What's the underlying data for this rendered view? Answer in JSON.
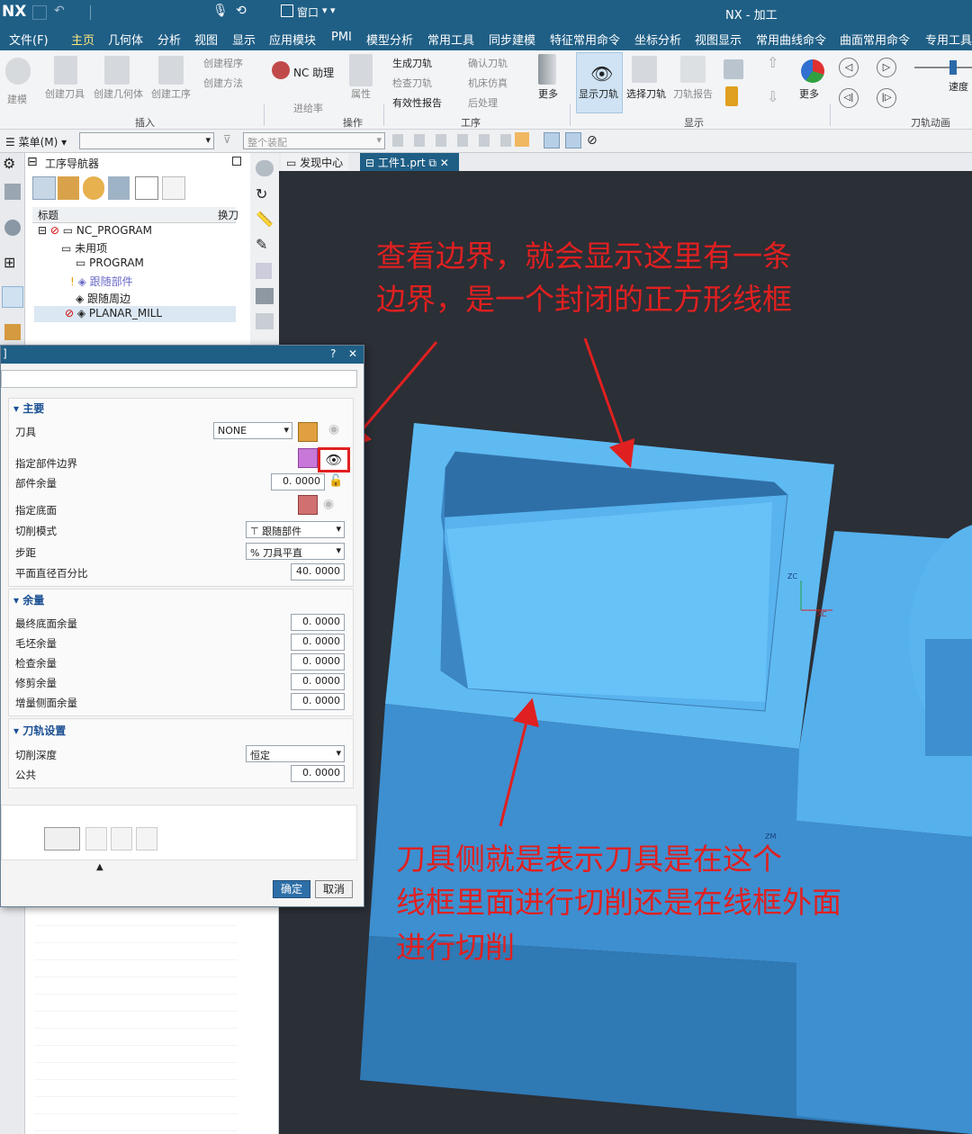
{
  "titlebar": {
    "logo": "NX",
    "window_menu": "窗口",
    "title": "NX - 加工"
  },
  "menubar": {
    "items": [
      "文件(F)",
      "主页",
      "几何体",
      "分析",
      "视图",
      "显示",
      "应用模块",
      "PMI",
      "模型分析",
      "常用工具",
      "同步建模",
      "特征常用命令",
      "坐标分析",
      "视图显示",
      "常用曲线命令",
      "曲面常用命令",
      "专用工具"
    ]
  },
  "ribbon": {
    "build": "建模",
    "create_tool": "创建刀具",
    "create_geometry": "创建几何体",
    "create_operation": "创建工序",
    "create_program": "创建程序",
    "create_method": "创建方法",
    "group_insert": "插入",
    "nc_assist": "NC 助理",
    "attributes": "属性",
    "feed_rate": "进给率",
    "group_operation": "操作",
    "generate_path": "生成刀轨",
    "verify_path": "确认刀轨",
    "check_tool": "检查刀轨",
    "machine_sim": "机床仿真",
    "validity_report": "有效性报告",
    "post_process": "后处理",
    "more1": "更多",
    "group_process": "工序",
    "show_path": "显示刀轨",
    "select_path": "选择刀轨",
    "path_report": "刀轨报告",
    "more2": "更多",
    "group_display": "显示",
    "speed": "速度",
    "group_animation": "刀轨动画"
  },
  "toolbar2": {
    "menu": "菜单(M)",
    "assembly": "整个装配"
  },
  "tabs": {
    "discover": "发现中心",
    "part": "工件1.prt"
  },
  "navigator": {
    "title": "工序导航器",
    "col_title": "标题",
    "col_tool": "换刀",
    "rows": [
      "NC_PROGRAM",
      "未用项",
      "PROGRAM",
      "跟随部件",
      "跟随周边",
      "PLANAR_MILL"
    ]
  },
  "dialog": {
    "help": "?",
    "close": "✕",
    "section_main": "主要",
    "tool_label": "刀具",
    "tool_value": "NONE",
    "part_boundary": "指定部件边界",
    "part_stock": "部件余量",
    "part_stock_value": "0. 0000",
    "floor": "指定底面",
    "cut_pattern": "切削模式",
    "cut_pattern_value": "跟随部件",
    "stepover": "步距",
    "stepover_value": "% 刀具平直",
    "flat_pct": "平面直径百分比",
    "flat_pct_value": "40. 0000",
    "section_stock": "余量",
    "final_floor": "最终底面余量",
    "blank_stock": "毛坯余量",
    "check_stock": "检查余量",
    "trim_stock": "修剪余量",
    "incr_side": "增量侧面余量",
    "zero": "0. 0000",
    "section_path": "刀轨设置",
    "cut_depth": "切削深度",
    "cut_depth_value": "恒定",
    "common": "公共",
    "ok": "确定",
    "cancel": "取消"
  },
  "annotations": {
    "top1": "查看边界，就会显示这里有一条",
    "top2": "边界，是一个封闭的正方形线框",
    "bottom1": "刀具侧就是表示刀具是在这个",
    "bottom2": "线框里面进行切削还是在线框外面",
    "bottom3": "进行切削"
  },
  "viewport": {
    "zc": "ZC",
    "xc": "XC",
    "zm": "ZM"
  },
  "colors": {
    "accent": "#1f5f86",
    "model": "#5bb8f0",
    "annotation": "#e02020"
  }
}
